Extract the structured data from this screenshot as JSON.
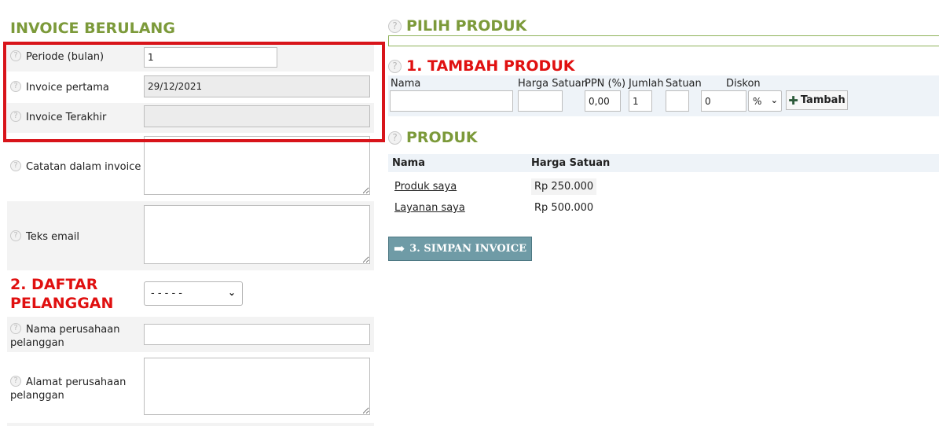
{
  "left": {
    "title": "INVOICE BERULANG",
    "fields": {
      "periode": {
        "label": "Periode (bulan)",
        "value": "1"
      },
      "pertama": {
        "label": "Invoice pertama",
        "value": "29/12/2021"
      },
      "terakhir": {
        "label": "Invoice Terakhir",
        "value": ""
      },
      "catatan": {
        "label": "Catatan dalam invoice",
        "value": ""
      },
      "teks_email": {
        "label": "Teks email",
        "value": ""
      }
    },
    "pelanggan": {
      "title_line1": "2. DAFTAR",
      "title_line2": "PELANGGAN",
      "select_value": "- - - - -",
      "nama_label_line1": "Nama perusahaan",
      "nama_label_line2": "pelanggan",
      "alamat_label_line1": "Alamat perusahaan",
      "alamat_label_line2": "pelanggan"
    }
  },
  "right": {
    "pilih_title": "PILIH PRODUK",
    "tambah_title": "1. TAMBAH PRODUK",
    "tambah": {
      "col_nama": "Nama",
      "col_harga": "Harga Satuan",
      "col_ppn": "PPN (%)",
      "col_jumlah": "Jumlah",
      "col_satuan": "Satuan",
      "col_diskon": "Diskon",
      "ppn_value": "0,00",
      "jumlah_value": "1",
      "diskon_value": "0",
      "diskon_unit": "%",
      "add_label": "Tambah"
    },
    "produk_title": "PRODUK",
    "produk_table": {
      "headers": [
        "Nama",
        "Harga Satuan"
      ],
      "rows": [
        {
          "nama": "Produk saya",
          "harga": "Rp 250.000"
        },
        {
          "nama": "Layanan saya",
          "harga": "Rp 500.000"
        }
      ]
    },
    "save_label": "3. SIMPAN INVOICE"
  },
  "icons": {
    "help": "?",
    "plus": "✚",
    "arrow": "➡",
    "chevron": "⌄"
  }
}
